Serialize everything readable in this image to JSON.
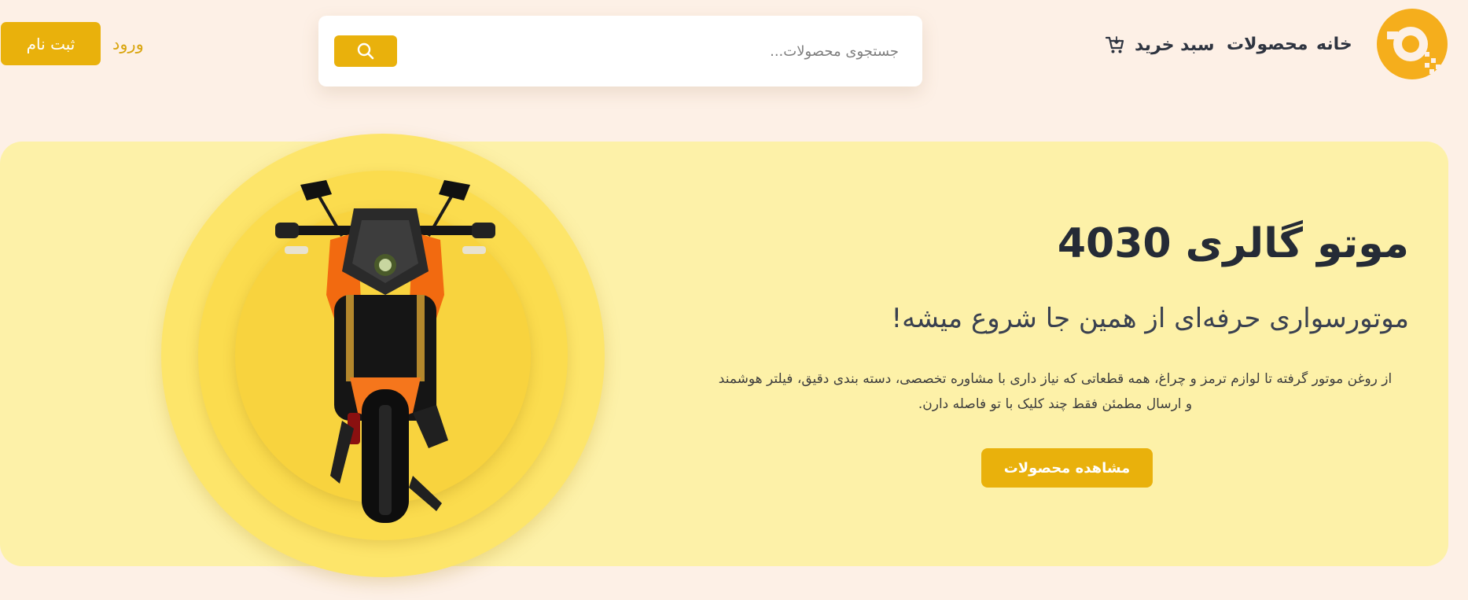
{
  "header": {
    "logo": {
      "icon": "logo-icon",
      "color": "#f5ae1c"
    },
    "nav": {
      "home": "خانه",
      "products": "محصولات",
      "cart": "سبد خرید"
    },
    "search": {
      "placeholder": "جستجوی محصولات...",
      "button_icon": "search-icon"
    },
    "auth": {
      "login": "ورود",
      "signup": "ثبت نام"
    }
  },
  "hero": {
    "title": "موتو گالری 4030",
    "subtitle": "موتورسواری حرفه‌ای از همین جا شروع میشه!",
    "description": "از روغن موتور گرفته تا لوازم ترمز و چراغ، همه قطعاتی که نیاز داری با مشاوره تخصصی، دسته بندی دقیق، فیلتر هوشمند و ارسال مطمئن فقط چند کلیک با تو فاصله دارن.",
    "cta": "مشاهده محصولات"
  },
  "colors": {
    "accent": "#e9b10c",
    "page_background": "#fdf0e6",
    "hero_background": "#fdf1a8",
    "text_dark": "#252b36"
  }
}
